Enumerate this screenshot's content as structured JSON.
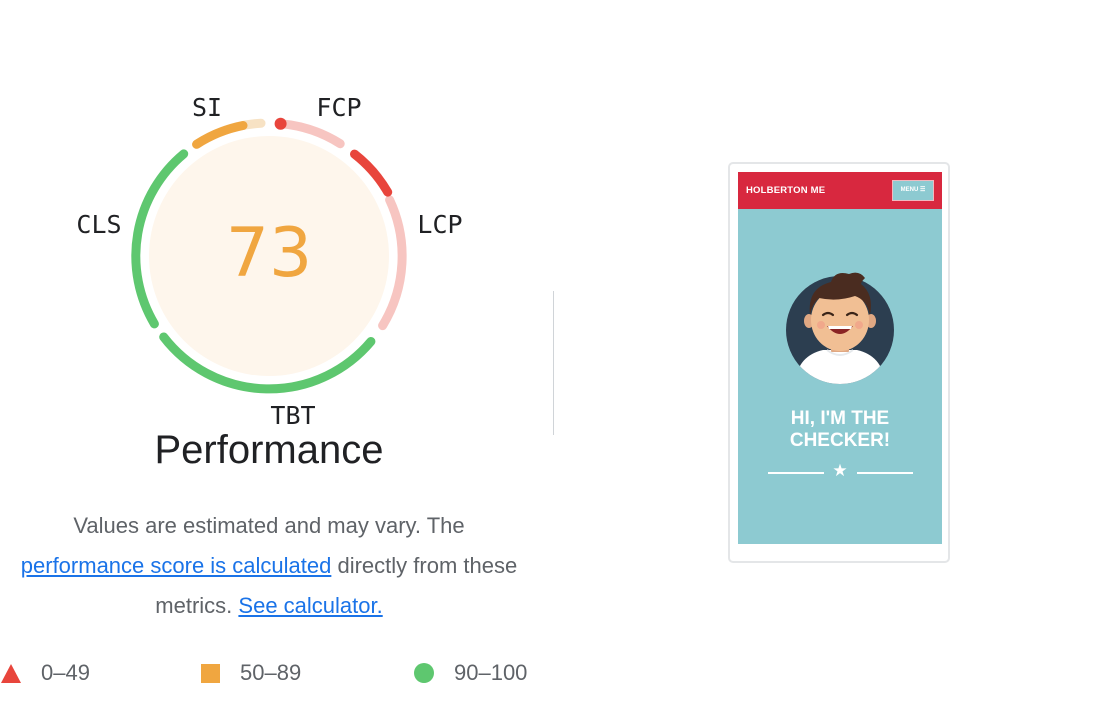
{
  "gauge": {
    "score": "73",
    "score_color": "#f0a640",
    "metrics": {
      "si": "SI",
      "fcp": "FCP",
      "lcp": "LCP",
      "cls": "CLS",
      "tbt": "TBT"
    }
  },
  "performance": {
    "title": "Performance",
    "desc_text1": "Values are estimated and may vary. The",
    "desc_link1": "performance score is calculated",
    "desc_text2": "directly from these metrics.",
    "desc_link2": "See calculator."
  },
  "legend": {
    "items": [
      {
        "label": "0–49",
        "icon": "triangle-icon",
        "color": "#e8453c"
      },
      {
        "label": "50–89",
        "icon": "square-icon",
        "color": "#f0a640"
      },
      {
        "label": "90–100",
        "icon": "circle-icon",
        "color": "#5ec76f"
      }
    ]
  },
  "preview": {
    "brand": "HOLBERTON ME",
    "menu_label": "MENU ☰",
    "hero_title_line1": "HI, I'M THE",
    "hero_title_line2": "CHECKER!",
    "colors": {
      "header": "#d8283f",
      "background": "#8dcad1"
    }
  }
}
